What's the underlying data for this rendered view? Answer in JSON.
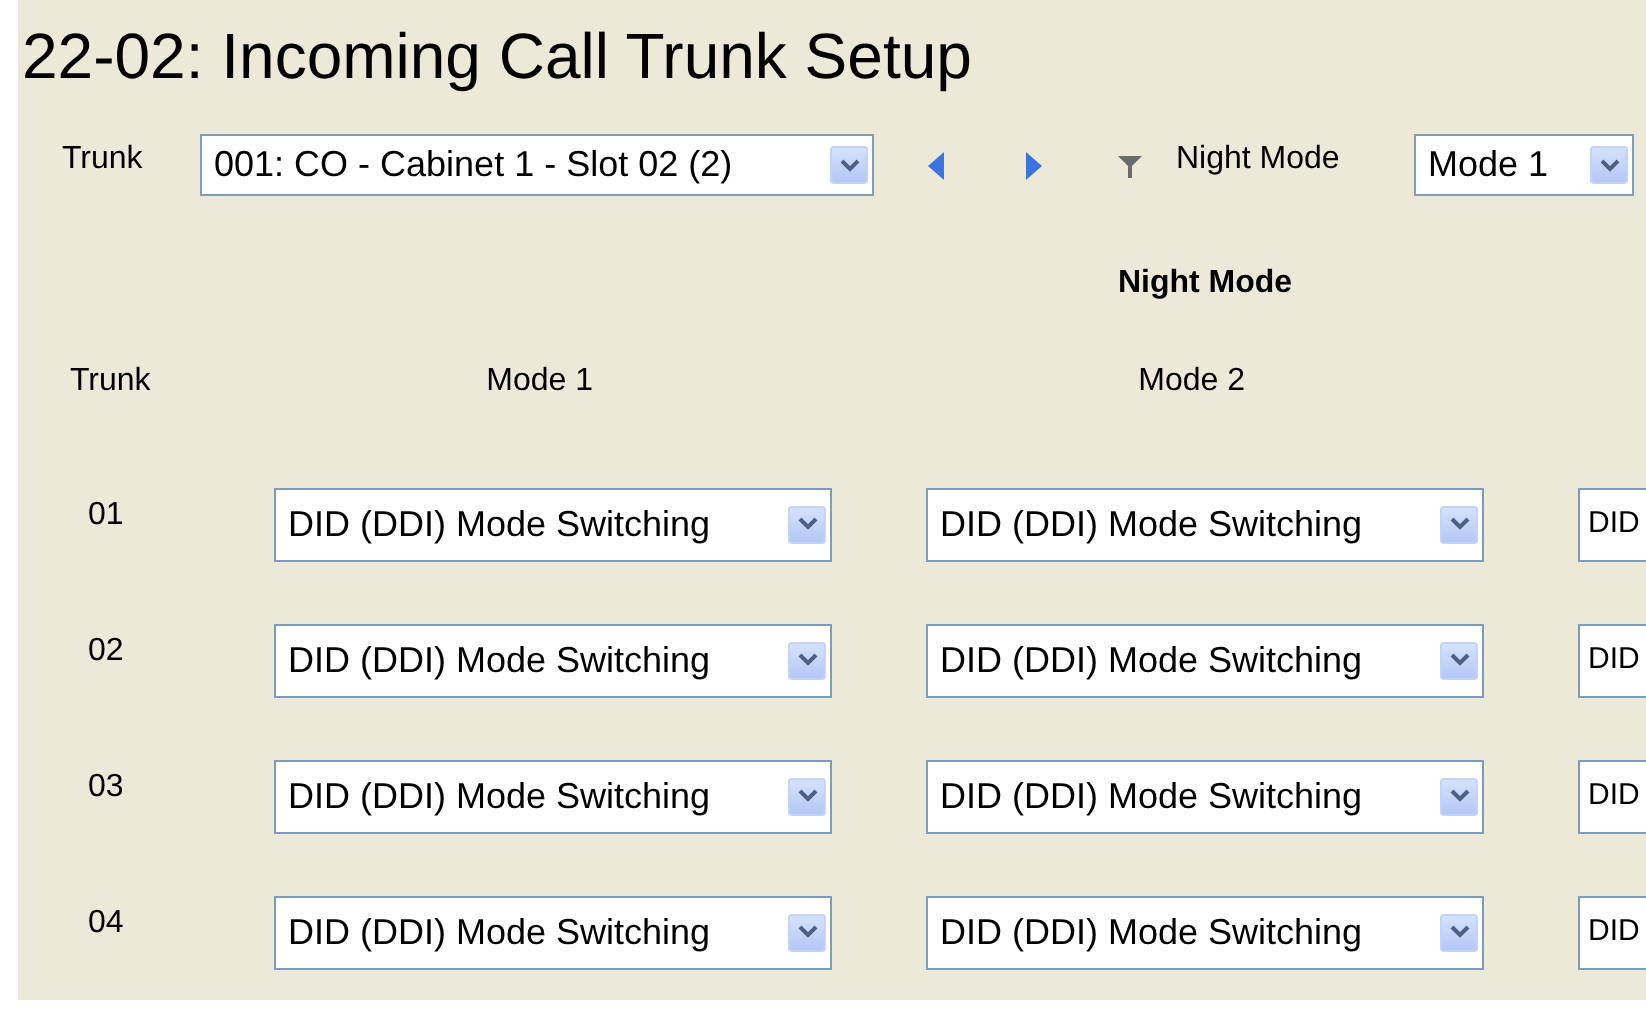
{
  "title": "22-02: Incoming Call Trunk Setup",
  "toolbar": {
    "trunk_label": "Trunk",
    "trunk_select": "001: CO - Cabinet 1 - Slot 02 (2)",
    "night_mode_label": "Night Mode",
    "night_mode_select": "Mode 1"
  },
  "table": {
    "group_header": "Night Mode",
    "columns": [
      "Trunk",
      "Mode 1",
      "Mode 2"
    ],
    "rows": [
      {
        "trunk": "01",
        "modes": [
          "DID (DDI) Mode Switching",
          "DID (DDI) Mode Switching",
          "DID"
        ]
      },
      {
        "trunk": "02",
        "modes": [
          "DID (DDI) Mode Switching",
          "DID (DDI) Mode Switching",
          "DID"
        ]
      },
      {
        "trunk": "03",
        "modes": [
          "DID (DDI) Mode Switching",
          "DID (DDI) Mode Switching",
          "DID"
        ]
      },
      {
        "trunk": "04",
        "modes": [
          "DID (DDI) Mode Switching",
          "DID (DDI) Mode Switching",
          "DID"
        ]
      }
    ]
  }
}
